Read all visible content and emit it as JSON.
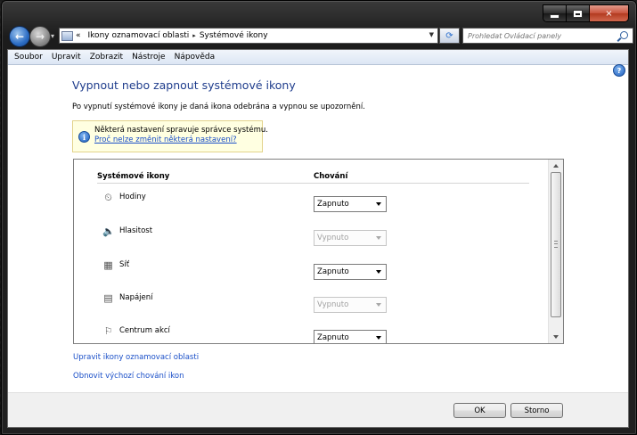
{
  "window": {
    "caption_buttons": {
      "minimize": "minimize-icon",
      "maximize": "maximize-icon",
      "close": "×"
    }
  },
  "nav": {
    "back_icon": "←",
    "forward_icon": "→",
    "breadcrumb_prefix": "«",
    "breadcrumb": [
      "Ikony oznamovací oblasti",
      "Systémové ikony"
    ],
    "breadcrumb_separator": "▸",
    "refresh_icon": "⟳",
    "search_placeholder": "Prohledat Ovládací panely"
  },
  "menu": [
    "Soubor",
    "Upravit",
    "Zobrazit",
    "Nástroje",
    "Nápověda"
  ],
  "help_icon": "?",
  "page": {
    "title": "Vypnout nebo zapnout systémové ikony",
    "intro": "Po vypnutí systémové ikony je daná ikona odebrána a vypnou se upozornění."
  },
  "info": {
    "icon": "i",
    "text": "Některá nastavení spravuje správce systému.",
    "link": "Proč nelze změnit některá nastavení?"
  },
  "table": {
    "col_icons": "Systémové ikony",
    "col_behavior": "Chování",
    "rows": [
      {
        "label": "Hodiny",
        "icon": "clock-icon",
        "glyph": "⏲",
        "value": "Zapnuto",
        "disabled": false
      },
      {
        "label": "Hlasitost",
        "icon": "volume-icon",
        "glyph": "🔈",
        "value": "Vypnuto",
        "disabled": true
      },
      {
        "label": "Síť",
        "icon": "network-icon",
        "glyph": "▦",
        "value": "Zapnuto",
        "disabled": false
      },
      {
        "label": "Napájení",
        "icon": "power-icon",
        "glyph": "▤",
        "value": "Vypnuto",
        "disabled": true
      },
      {
        "label": "Centrum akcí",
        "icon": "flag-icon",
        "glyph": "⚐",
        "value": "Zapnuto",
        "disabled": false
      }
    ]
  },
  "links": {
    "customize": "Upravit ikony oznamovací oblasti",
    "restore": "Obnovit výchozí chování ikon"
  },
  "buttons": {
    "ok": "OK",
    "cancel": "Storno"
  }
}
